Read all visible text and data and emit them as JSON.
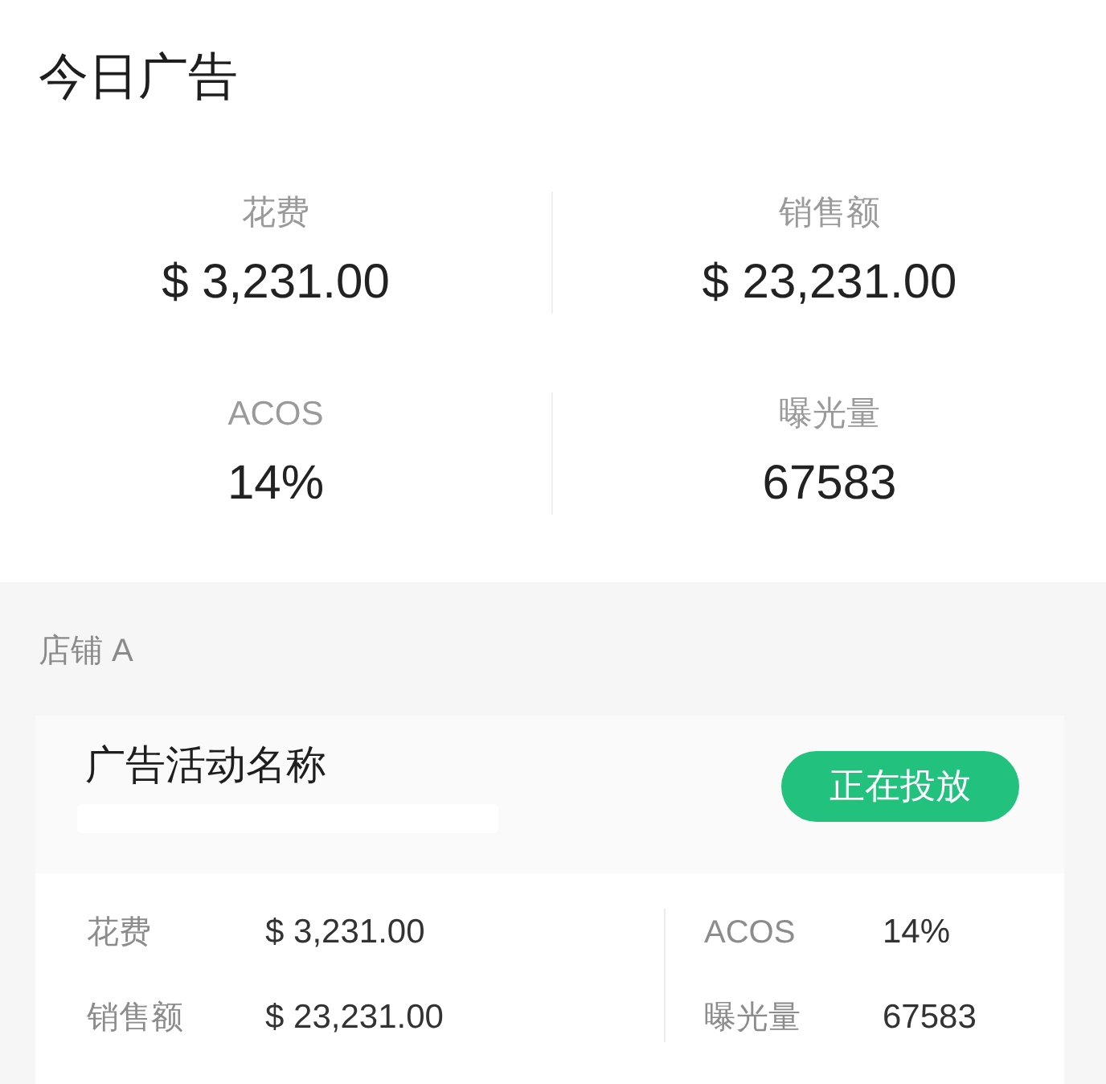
{
  "title": "今日广告",
  "summary": [
    {
      "label": "花费",
      "value": "$ 3,231.00"
    },
    {
      "label": "销售额",
      "value": "$ 23,231.00"
    },
    {
      "label": "ACOS",
      "value": "14%"
    },
    {
      "label": "曝光量",
      "value": "67583"
    }
  ],
  "stores": [
    {
      "name": "店铺 A",
      "campaigns": [
        {
          "name": "广告活动名称",
          "status": "正在投放",
          "metric_groups": [
            {
              "items": [
                {
                  "label": "花费",
                  "value": "$ 3,231.00"
                },
                {
                  "label": "销售额",
                  "value": "$ 23,231.00"
                }
              ]
            },
            {
              "items": [
                {
                  "label": "ACOS",
                  "value": "14%"
                },
                {
                  "label": "曝光量",
                  "value": "67583"
                }
              ]
            }
          ]
        }
      ]
    }
  ]
}
